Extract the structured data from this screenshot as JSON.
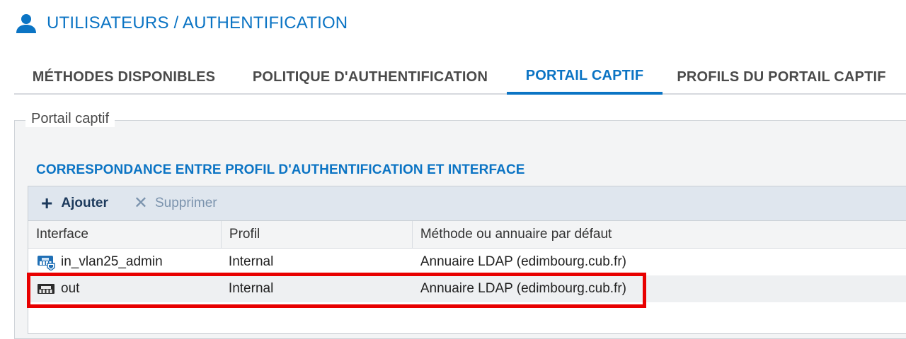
{
  "header": {
    "title": "UTILISATEURS / AUTHENTIFICATION",
    "icon": "user-icon"
  },
  "tabs": [
    {
      "label": "MÉTHODES DISPONIBLES",
      "active": false
    },
    {
      "label": "POLITIQUE D'AUTHENTIFICATION",
      "active": false
    },
    {
      "label": "PORTAIL CAPTIF",
      "active": true
    },
    {
      "label": "PROFILS DU PORTAIL CAPTIF",
      "active": false
    }
  ],
  "fieldset": {
    "legend": "Portail captif"
  },
  "section": {
    "title": "CORRESPONDANCE ENTRE PROFIL D'AUTHENTIFICATION ET INTERFACE"
  },
  "toolbar": {
    "add_label": "Ajouter",
    "delete_label": "Supprimer"
  },
  "table": {
    "columns": [
      "Interface",
      "Profil",
      "Méthode ou annuaire par défaut"
    ],
    "rows": [
      {
        "interface": "in_vlan25_admin",
        "icon": "vlan-interface-icon",
        "profile": "Internal",
        "method": "Annuaire LDAP (edimbourg.cub.fr)"
      },
      {
        "interface": "out",
        "icon": "ethernet-port-icon",
        "profile": "Internal",
        "method": "Annuaire LDAP (edimbourg.cub.fr)"
      }
    ]
  },
  "colors": {
    "accent": "#0b74c4",
    "highlight": "#e80000",
    "toolbar_bg": "#dfe6ee"
  }
}
